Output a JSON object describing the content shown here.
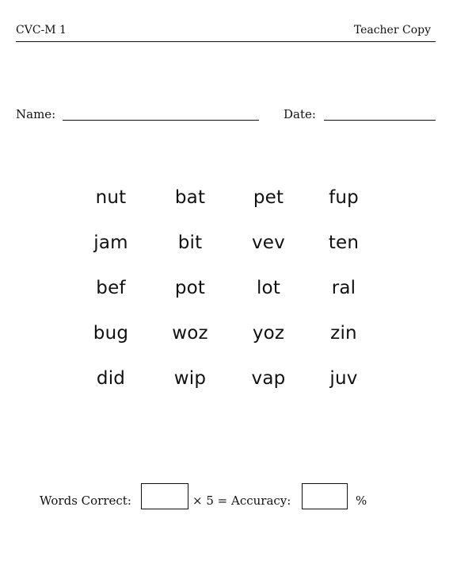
{
  "header": {
    "left_label": "CVC-M 1",
    "right_label": "Teacher Copy"
  },
  "fields": {
    "name_label": "Name:",
    "date_label": "Date:"
  },
  "word_grid": [
    [
      "nut",
      "bat",
      "pet",
      "fup"
    ],
    [
      "jam",
      "bit",
      "vev",
      "ten"
    ],
    [
      "bef",
      "pot",
      "lot",
      "ral"
    ],
    [
      "bug",
      "woz",
      "yoz",
      "zin"
    ],
    [
      "did",
      "wip",
      "vap",
      "juv"
    ]
  ],
  "scoring": {
    "words_correct_label": "Words Correct:",
    "multiplier_text": "× 5 = Accuracy:",
    "percent_symbol": "%"
  }
}
